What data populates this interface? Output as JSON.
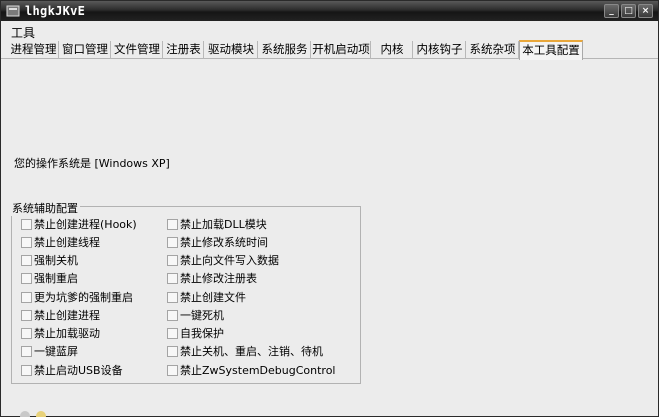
{
  "window": {
    "title": "lhgkJKvE",
    "buttons": {
      "minimize": "_",
      "maximize": "□",
      "close": "×"
    }
  },
  "menu": {
    "tools": "工具"
  },
  "tabs": [
    {
      "label": "进程管理",
      "active": false
    },
    {
      "label": "窗口管理",
      "active": false
    },
    {
      "label": "文件管理",
      "active": false
    },
    {
      "label": "注册表",
      "active": false
    },
    {
      "label": "驱动模块",
      "active": false
    },
    {
      "label": "系统服务",
      "active": false
    },
    {
      "label": "开机启动项",
      "active": false
    },
    {
      "label": "内核",
      "active": false
    },
    {
      "label": "内核钩子",
      "active": false
    },
    {
      "label": "系统杂项",
      "active": false
    },
    {
      "label": "本工具配置",
      "active": true
    }
  ],
  "main": {
    "os_text": "您的操作系统是 [Windows XP]",
    "group_title": "系统辅助配置",
    "left_options": [
      "禁止创建进程(Hook)",
      "禁止创建线程",
      "强制关机",
      "强制重启",
      "更为坑爹的强制重启",
      "禁止创建进程",
      "禁止加载驱动",
      "一键蓝屏",
      "禁止启动USB设备"
    ],
    "right_options": [
      "禁止加载DLL模块",
      "禁止修改系统时间",
      "禁止向文件写入数据",
      "禁止修改注册表",
      "禁止创建文件",
      "一键死机",
      "自我保护",
      "禁止关机、重启、注销、待机",
      "禁止ZwSystemDebugControl"
    ]
  },
  "colors": {
    "titlebar": "#1c1c1c",
    "background": "#ececec",
    "active_tab_accent": "#e9a73a"
  }
}
